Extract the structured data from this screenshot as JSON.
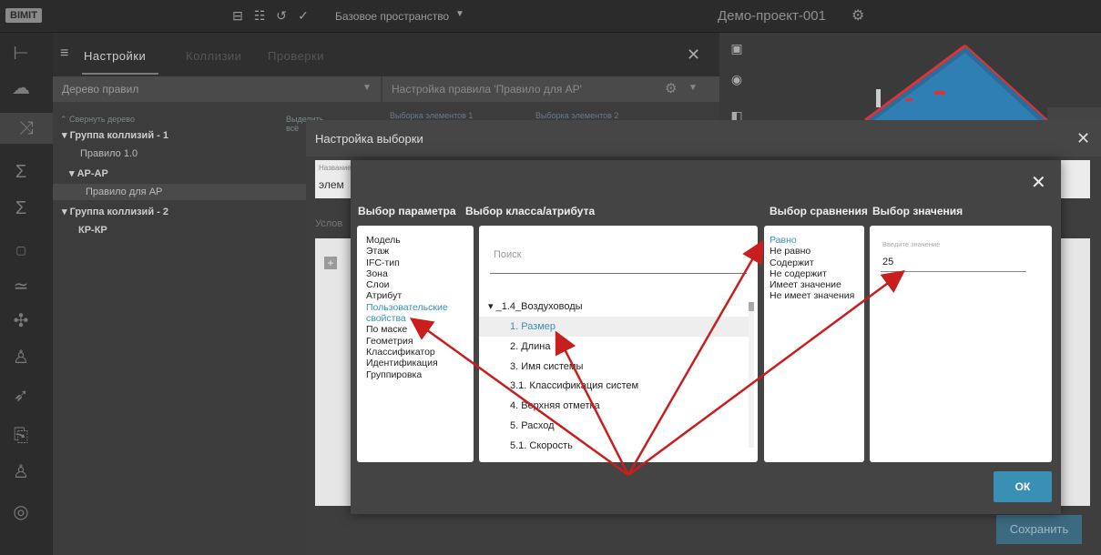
{
  "app": {
    "logo": "BIMIT",
    "space": "Базовое пространство",
    "project": "Демо-проект-001"
  },
  "icons": {
    "top": [
      "briefcase-icon",
      "users-icon",
      "history-icon",
      "check-circle-icon"
    ],
    "sidebar": [
      "tree-icon",
      "cloud-icon",
      "collisions-icon",
      "sum-icon",
      "sum-plus-icon",
      "2d-icon",
      "chart-icon",
      "puzzle-icon",
      "user-check-icon",
      "rocket-icon",
      "folder-arrow-icon",
      "user-location-icon",
      "compass-icon"
    ]
  },
  "panel": {
    "tabs": [
      "Настройки",
      "Коллизии",
      "Проверки"
    ],
    "tree_title": "Дерево правил",
    "collapse_label": "Свернуть дерево",
    "select_all_label": "Выделить всё",
    "tree": [
      {
        "label": "Группа коллизий - 1",
        "bold": true
      },
      {
        "label": "Правило 1.0"
      },
      {
        "label": "АР-АР",
        "bold": true
      },
      {
        "label": "Правило для АР",
        "selected": true
      },
      {
        "label": "Группа коллизий - 2",
        "bold": true
      },
      {
        "label": "КР-КР",
        "bold": true
      }
    ],
    "rule_title": "Настройка правила 'Правило для АР'",
    "rule_sub1": "Выборка элементов 1",
    "rule_sub2": "Выборка элементов 2"
  },
  "modal_outer": {
    "title": "Настройка выборки",
    "field_label": "Название",
    "field_value": "элем",
    "conditions_label": "Услов",
    "save_label": "Сохранить"
  },
  "modal_inner": {
    "col_param_title": "Выбор параметра",
    "col_class_title": "Выбор класса/атрибута",
    "col_compare_title": "Выбор сравнения",
    "col_value_title": "Выбор значения",
    "params": [
      "Модель",
      "Этаж",
      "IFC-тип",
      "Зона",
      "Слои",
      "Атрибут",
      "Пользовательские",
      "свойства",
      "По маске",
      "Геометрия",
      "Классификатор",
      "Идентификация",
      "Группировка"
    ],
    "params_active": [
      6,
      7
    ],
    "search_placeholder": "Поиск",
    "class_group": "_1.4_Воздуховоды",
    "class_items": [
      "1. Размер",
      "2. Длина",
      "3. Имя системы",
      "3.1. Классификация систем",
      "4. Верхняя отметка",
      "5. Расход",
      "5.1. Скорость"
    ],
    "class_selected": 0,
    "comparisons": [
      "Равно",
      "Не равно",
      "Содержит",
      "Не содержит",
      "Имеет значение",
      "Не имеет значения"
    ],
    "comparison_active": 0,
    "value_label": "Введите значение",
    "value": "25",
    "ok_label": "ОК"
  },
  "colors": {
    "accent": "#3a8fb5",
    "arrow": "#c81e1e",
    "save_bg": "#3c6a80"
  }
}
